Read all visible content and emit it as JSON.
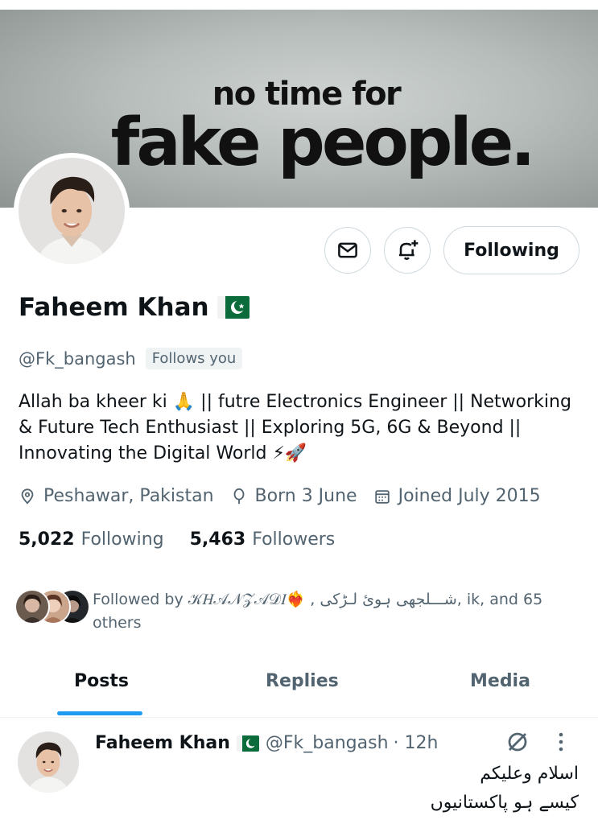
{
  "banner": {
    "line1": "no time for",
    "line2": "fake people."
  },
  "actions": {
    "message_icon": "envelope-icon",
    "notify_icon": "bell-plus-icon",
    "follow_label": "Following"
  },
  "profile": {
    "name": "Faheem Khan",
    "flag": "pakistan-flag",
    "handle": "@Fk_bangash",
    "follows_you": "Follows you",
    "bio_lines": [
      "Allah ba kheer ki 🙏 || futre Electronics Engineer || Networking",
      "& Future Tech Enthusiast || Exploring 5G, 6G & Beyond ||",
      "Innovating the Digital World ⚡🚀"
    ],
    "location": "Peshawar, Pakistan",
    "born": "Born 3 June",
    "joined": "Joined July 2015",
    "following_count": "5,022",
    "following_label": "Following",
    "followers_count": "5,463",
    "followers_label": "Followers",
    "followed_by_line1": "Followed by 𝒦𝐻𝒜𝒩𝒵𝒜𝒟𝐼❤️‍🔥 , شـــلجھی ہوئ لـڑکی, ik, and 65",
    "followed_by_line2": "others"
  },
  "tabs": [
    {
      "label": "Posts",
      "active": true
    },
    {
      "label": "Replies",
      "active": false
    },
    {
      "label": "Media",
      "active": false
    }
  ],
  "post": {
    "name": "Faheem Khan",
    "handle": "@Fk_bangash",
    "time": "· 12h",
    "line1": "اسلام وعلیکم",
    "line2": "کیسے ہو پاکستانیوں"
  },
  "colors": {
    "accent": "#1d9bf0",
    "text_primary": "#0f1419",
    "text_secondary": "#536471",
    "border": "#cfd9de",
    "flag_green": "#0b6b3a"
  }
}
